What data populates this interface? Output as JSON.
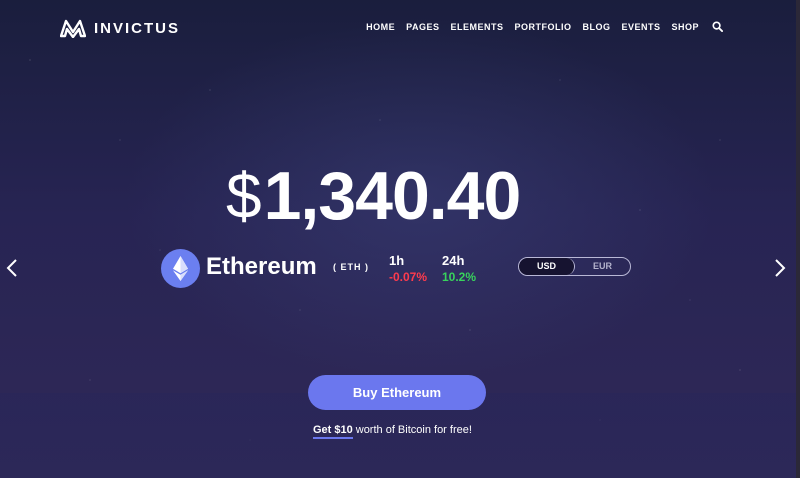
{
  "brand": {
    "name": "INVICTUS",
    "icon": "invictus-logo-icon"
  },
  "nav": {
    "items": [
      "HOME",
      "PAGES",
      "ELEMENTS",
      "PORTFOLIO",
      "BLOG",
      "EVENTS",
      "SHOP"
    ],
    "search_icon": "search-icon"
  },
  "hero": {
    "currency_symbol": "$",
    "price": "1,340.40",
    "coin": {
      "name": "Ethereum",
      "symbol": "( ETH )",
      "icon": "ethereum-icon"
    },
    "stats": [
      {
        "label": "1h",
        "value": "-0.07%",
        "color": "#ff3b4d"
      },
      {
        "label": "24h",
        "value": "10.2%",
        "color": "#38d35c"
      }
    ],
    "currency_toggle": {
      "options": [
        "USD",
        "EUR"
      ],
      "selected": "USD"
    },
    "arrows": {
      "prev": "chevron-left-icon",
      "next": "chevron-right-icon"
    }
  },
  "cta": {
    "button_label": "Buy Ethereum",
    "promo_link": "Get $10",
    "promo_text": "worth of Bitcoin for free!"
  },
  "colors": {
    "accent": "#6b77ee",
    "negative": "#ff3b4d",
    "positive": "#38d35c",
    "background": "#272453"
  }
}
